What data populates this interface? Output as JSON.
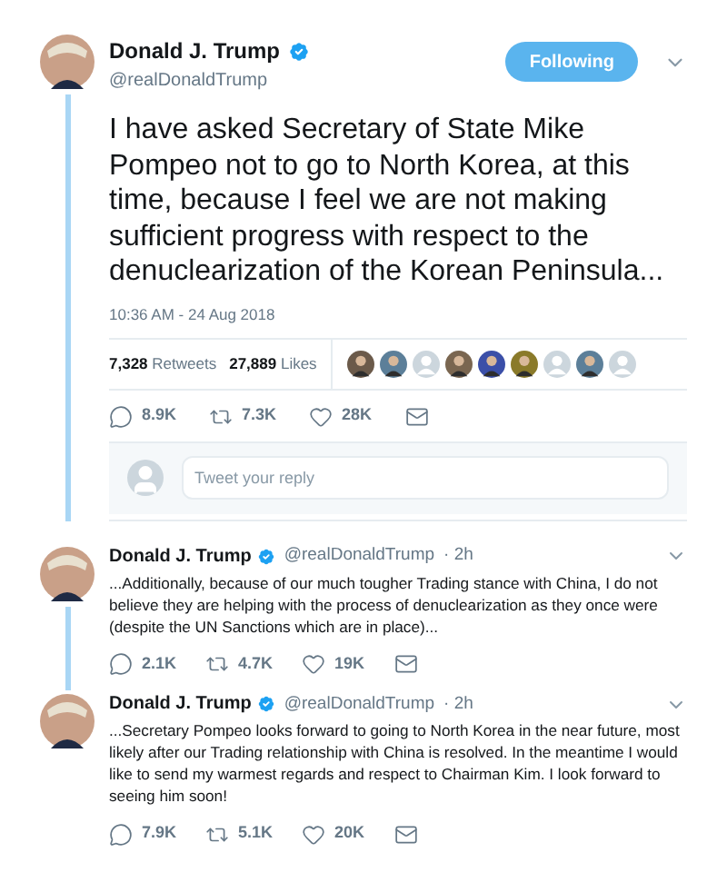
{
  "main_tweet": {
    "name": "Donald J. Trump",
    "verified": true,
    "handle": "@realDonaldTrump",
    "follow_button": "Following",
    "following": true,
    "text": "I have asked Secretary of State Mike Pompeo not to go to North Korea, at this time, because I feel we are not making sufficient progress with respect to the denuclearization of the Korean Peninsula...",
    "timestamp": "10:36 AM - 24 Aug 2018",
    "stats": [
      {
        "count": "7,328",
        "label": "Retweets"
      },
      {
        "count": "27,889",
        "label": "Likes"
      }
    ],
    "likers": [
      {
        "kind": "picture"
      },
      {
        "kind": "picture"
      },
      {
        "kind": "default"
      },
      {
        "kind": "picture"
      },
      {
        "kind": "picture"
      },
      {
        "kind": "picture"
      },
      {
        "kind": "default"
      },
      {
        "kind": "picture"
      },
      {
        "kind": "default"
      }
    ],
    "actions": [
      {
        "kind": "reply",
        "count": "8.9K"
      },
      {
        "kind": "retweet",
        "count": "7.3K"
      },
      {
        "kind": "like",
        "count": "28K"
      },
      {
        "kind": "message"
      }
    ]
  },
  "reply_box": {
    "placeholder": "Tweet your reply"
  },
  "replies": [
    {
      "name": "Donald J. Trump",
      "verified": true,
      "handle": "@realDonaldTrump",
      "time": "· 2h",
      "text": "...Additionally, because of our much tougher Trading stance with China, I do not believe they are helping with the process of denuclearization as they once were (despite the UN Sanctions which are in place)...",
      "actions": [
        {
          "kind": "reply",
          "count": "2.1K"
        },
        {
          "kind": "retweet",
          "count": "4.7K"
        },
        {
          "kind": "like",
          "count": "19K"
        },
        {
          "kind": "message"
        }
      ]
    },
    {
      "name": "Donald J. Trump",
      "verified": true,
      "handle": "@realDonaldTrump",
      "time": "· 2h",
      "text": "...Secretary Pompeo looks forward to going to North Korea in the near future, most likely after our Trading relationship with China is resolved. In the meantime I would like to send my warmest regards and respect to Chairman Kim. I look forward to seeing him soon!",
      "actions": [
        {
          "kind": "reply",
          "count": "7.9K"
        },
        {
          "kind": "retweet",
          "count": "5.1K"
        },
        {
          "kind": "like",
          "count": "20K"
        },
        {
          "kind": "message"
        }
      ]
    }
  ]
}
